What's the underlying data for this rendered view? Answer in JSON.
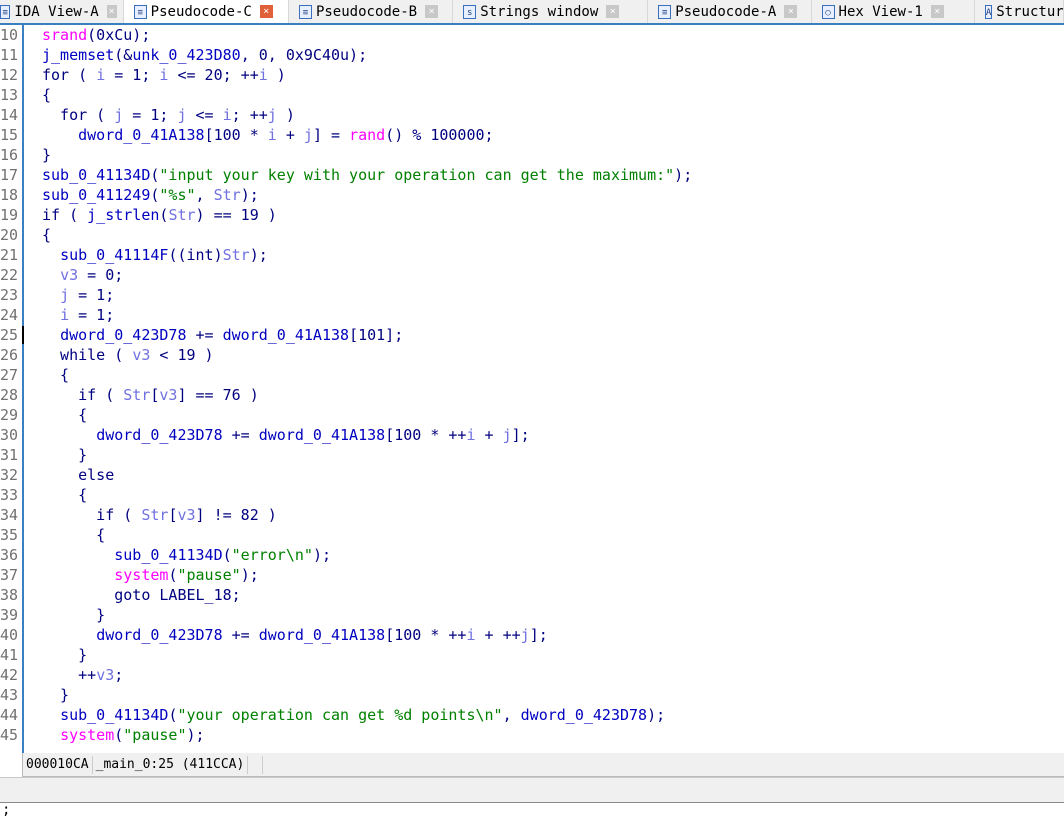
{
  "tabs": [
    {
      "label": "IDA View-A",
      "icon": "ida-view-icon",
      "active": false
    },
    {
      "label": "Pseudocode-C",
      "icon": "pseudocode-icon",
      "active": true
    },
    {
      "label": "Pseudocode-B",
      "icon": "pseudocode-icon",
      "active": false
    },
    {
      "label": "Strings window",
      "icon": "strings-icon",
      "active": false
    },
    {
      "label": "Pseudocode-A",
      "icon": "pseudocode-icon",
      "active": false
    },
    {
      "label": "Hex View-1",
      "icon": "hex-view-icon",
      "active": false
    },
    {
      "label": "Structures",
      "icon": "structures-icon",
      "active": false
    }
  ],
  "code": [
    {
      "n": "10",
      "t": [
        [
          "f",
          "srand"
        ],
        [
          "k",
          "(0xCu);"
        ]
      ]
    },
    {
      "n": "11",
      "t": [
        [
          "n",
          "j_memset"
        ],
        [
          "k",
          "(&"
        ],
        [
          "n",
          "unk_0_423D80"
        ],
        [
          "k",
          ", 0, 0x9C40u);"
        ]
      ]
    },
    {
      "n": "12",
      "t": [
        [
          "k",
          "for ( "
        ],
        [
          "v",
          "i"
        ],
        [
          "k",
          " = 1; "
        ],
        [
          "v",
          "i"
        ],
        [
          "k",
          " <= 20; ++"
        ],
        [
          "v",
          "i"
        ],
        [
          "k",
          " )"
        ]
      ]
    },
    {
      "n": "13",
      "t": [
        [
          "k",
          "{"
        ]
      ]
    },
    {
      "n": "14",
      "t": [
        [
          "k",
          "  for ( "
        ],
        [
          "v",
          "j"
        ],
        [
          "k",
          " = 1; "
        ],
        [
          "v",
          "j"
        ],
        [
          "k",
          " <= "
        ],
        [
          "v",
          "i"
        ],
        [
          "k",
          "; ++"
        ],
        [
          "v",
          "j"
        ],
        [
          "k",
          " )"
        ]
      ]
    },
    {
      "n": "15",
      "t": [
        [
          "k",
          "    "
        ],
        [
          "n",
          "dword_0_41A138"
        ],
        [
          "k",
          "[100 * "
        ],
        [
          "v",
          "i"
        ],
        [
          "k",
          " + "
        ],
        [
          "v",
          "j"
        ],
        [
          "k",
          "] = "
        ],
        [
          "f",
          "rand"
        ],
        [
          "k",
          "() % 100000;"
        ]
      ]
    },
    {
      "n": "16",
      "t": [
        [
          "k",
          "}"
        ]
      ]
    },
    {
      "n": "17",
      "t": [
        [
          "n",
          "sub_0_41134D"
        ],
        [
          "k",
          "("
        ],
        [
          "s",
          "\"input your key with your operation can get the maximum:\""
        ],
        [
          "k",
          ");"
        ]
      ]
    },
    {
      "n": "18",
      "t": [
        [
          "n",
          "sub_0_411249"
        ],
        [
          "k",
          "("
        ],
        [
          "s",
          "\"%s\""
        ],
        [
          "k",
          ", "
        ],
        [
          "v",
          "Str"
        ],
        [
          "k",
          ");"
        ]
      ]
    },
    {
      "n": "19",
      "t": [
        [
          "k",
          "if ( "
        ],
        [
          "n",
          "j_strlen"
        ],
        [
          "k",
          "("
        ],
        [
          "v",
          "Str"
        ],
        [
          "k",
          ") == 19 )"
        ]
      ]
    },
    {
      "n": "20",
      "t": [
        [
          "k",
          "{"
        ]
      ]
    },
    {
      "n": "21",
      "t": [
        [
          "k",
          "  "
        ],
        [
          "n",
          "sub_0_41114F"
        ],
        [
          "k",
          "((int)"
        ],
        [
          "v",
          "Str"
        ],
        [
          "k",
          ");"
        ]
      ]
    },
    {
      "n": "22",
      "t": [
        [
          "k",
          "  "
        ],
        [
          "v",
          "v3"
        ],
        [
          "k",
          " = 0;"
        ]
      ]
    },
    {
      "n": "23",
      "t": [
        [
          "k",
          "  "
        ],
        [
          "v",
          "j"
        ],
        [
          "k",
          " = 1;"
        ]
      ]
    },
    {
      "n": "24",
      "t": [
        [
          "k",
          "  "
        ],
        [
          "v",
          "i"
        ],
        [
          "k",
          " = 1;"
        ]
      ]
    },
    {
      "n": "25",
      "t": [
        [
          "k",
          "  "
        ],
        [
          "n",
          "dword_0_423D78"
        ],
        [
          "k",
          " += "
        ],
        [
          "n",
          "dword_0_41A138"
        ],
        [
          "k",
          "[101];"
        ]
      ]
    },
    {
      "n": "26",
      "t": [
        [
          "k",
          "  while ( "
        ],
        [
          "v",
          "v3"
        ],
        [
          "k",
          " < 19 )"
        ]
      ]
    },
    {
      "n": "27",
      "t": [
        [
          "k",
          "  {"
        ]
      ]
    },
    {
      "n": "28",
      "t": [
        [
          "k",
          "    if ( "
        ],
        [
          "v",
          "Str"
        ],
        [
          "k",
          "["
        ],
        [
          "v",
          "v3"
        ],
        [
          "k",
          "] == 76 )"
        ]
      ]
    },
    {
      "n": "29",
      "t": [
        [
          "k",
          "    {"
        ]
      ]
    },
    {
      "n": "30",
      "t": [
        [
          "k",
          "      "
        ],
        [
          "n",
          "dword_0_423D78"
        ],
        [
          "k",
          " += "
        ],
        [
          "n",
          "dword_0_41A138"
        ],
        [
          "k",
          "[100 * ++"
        ],
        [
          "v",
          "i"
        ],
        [
          "k",
          " + "
        ],
        [
          "v",
          "j"
        ],
        [
          "k",
          "];"
        ]
      ]
    },
    {
      "n": "31",
      "t": [
        [
          "k",
          "    }"
        ]
      ]
    },
    {
      "n": "32",
      "t": [
        [
          "k",
          "    else"
        ]
      ]
    },
    {
      "n": "33",
      "t": [
        [
          "k",
          "    {"
        ]
      ]
    },
    {
      "n": "34",
      "t": [
        [
          "k",
          "      if ( "
        ],
        [
          "v",
          "Str"
        ],
        [
          "k",
          "["
        ],
        [
          "v",
          "v3"
        ],
        [
          "k",
          "] != 82 )"
        ]
      ]
    },
    {
      "n": "35",
      "t": [
        [
          "k",
          "      {"
        ]
      ]
    },
    {
      "n": "36",
      "t": [
        [
          "k",
          "        "
        ],
        [
          "n",
          "sub_0_41134D"
        ],
        [
          "k",
          "("
        ],
        [
          "s",
          "\"error\\n\""
        ],
        [
          "k",
          ");"
        ]
      ]
    },
    {
      "n": "37",
      "t": [
        [
          "k",
          "        "
        ],
        [
          "f",
          "system"
        ],
        [
          "k",
          "("
        ],
        [
          "s",
          "\"pause\""
        ],
        [
          "k",
          ");"
        ]
      ]
    },
    {
      "n": "38",
      "t": [
        [
          "k",
          "        goto LABEL_18;"
        ]
      ]
    },
    {
      "n": "39",
      "t": [
        [
          "k",
          "      }"
        ]
      ]
    },
    {
      "n": "40",
      "t": [
        [
          "k",
          "      "
        ],
        [
          "n",
          "dword_0_423D78"
        ],
        [
          "k",
          " += "
        ],
        [
          "n",
          "dword_0_41A138"
        ],
        [
          "k",
          "[100 * ++"
        ],
        [
          "v",
          "i"
        ],
        [
          "k",
          " + ++"
        ],
        [
          "v",
          "j"
        ],
        [
          "k",
          "];"
        ]
      ]
    },
    {
      "n": "41",
      "t": [
        [
          "k",
          "    }"
        ]
      ]
    },
    {
      "n": "42",
      "t": [
        [
          "k",
          "    ++"
        ],
        [
          "v",
          "v3"
        ],
        [
          "k",
          ";"
        ]
      ]
    },
    {
      "n": "43",
      "t": [
        [
          "k",
          "  }"
        ]
      ]
    },
    {
      "n": "44",
      "t": [
        [
          "k",
          "  "
        ],
        [
          "n",
          "sub_0_41134D"
        ],
        [
          "k",
          "("
        ],
        [
          "s",
          "\"your operation can get %d points\\n\""
        ],
        [
          "k",
          ", "
        ],
        [
          "n",
          "dword_0_423D78"
        ],
        [
          "k",
          ");"
        ]
      ]
    },
    {
      "n": "45",
      "t": [
        [
          "k",
          "  "
        ],
        [
          "f",
          "system"
        ],
        [
          "k",
          "("
        ],
        [
          "s",
          "\"pause\""
        ],
        [
          "k",
          ");"
        ]
      ]
    }
  ],
  "status": {
    "address": "000010CA",
    "location": "_main_0:25 (411CCA)"
  },
  "output": {
    "text": ";"
  }
}
